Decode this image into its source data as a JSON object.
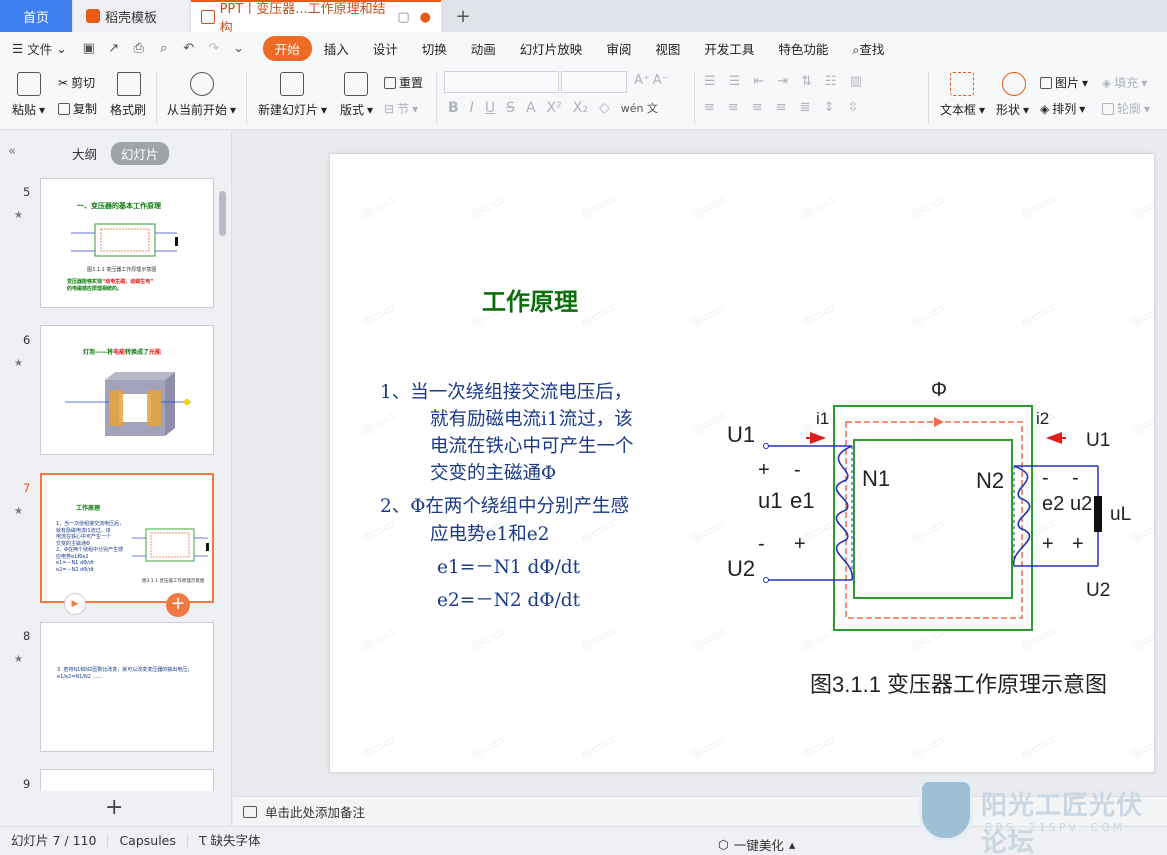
{
  "tabs": {
    "home": "首页",
    "template": "稻壳模板",
    "document": "PPT丨变压器...工作原理和结构",
    "new_tab": "+"
  },
  "menu": {
    "file": "文件",
    "items": [
      "开始",
      "插入",
      "设计",
      "切换",
      "动画",
      "幻灯片放映",
      "审阅",
      "视图",
      "开发工具",
      "特色功能"
    ],
    "search": "查找"
  },
  "ribbon": {
    "paste": "粘贴",
    "cut": "剪切",
    "copy": "复制",
    "format_painter": "格式刷",
    "from_current": "从当前开始",
    "new_slide": "新建幻灯片",
    "layout": "版式",
    "reset": "重置",
    "section": "节",
    "textbox": "文本框",
    "shape": "形状",
    "picture": "图片",
    "fill": "填充",
    "arrange": "排列",
    "outline": "轮廓",
    "phonetic": "wén 文"
  },
  "left_panel": {
    "outline_tab": "大纲",
    "slides_tab": "幻灯片",
    "slide_numbers": [
      "5",
      "6",
      "7",
      "8",
      "9"
    ],
    "thumb5": {
      "title": "一、变压器的基本工作原理",
      "caption": "图3.1.1  变压器工作原理示意图",
      "note_a": "变压器能够实现",
      "note_b": "“动电生磁，动磁生电”",
      "note_c": "的电磁感应原理相统的。"
    },
    "thumb6": {
      "title_a": "灯泡——将",
      "title_b": "电能",
      "title_c": "转换成了",
      "title_d": "光能"
    },
    "thumb7": {
      "title": "工作原理",
      "caption": "图3.1.1  变压器工作原理示意图"
    },
    "thumb8": {
      "text": "3. 若将N1和N2匝数比改变，就可以改变变压器的输出电压；e1/e2=N1/N2 ……"
    }
  },
  "slide": {
    "title": "工作原理",
    "lines": [
      "1、当一次绕组接交流电压后，",
      "就有励磁电流i1流过，该",
      "电流在铁心中可产生一个",
      "交变的主磁通Φ",
      "2、Φ在两个绕组中分别产生感",
      "应电势e1和e2",
      "e1=－N1 dΦ/dt",
      "e2=－N2 dΦ/dt"
    ],
    "diagram": {
      "phi": "Φ",
      "i1": "i1",
      "i2": "i2",
      "U1_left": "U1",
      "U2_left": "U2",
      "u1": "u1",
      "e1": "e1",
      "N1": "N1",
      "N2": "N2",
      "e2": "e2",
      "u2": "u2",
      "U1_right": "U1",
      "U2_right": "U2",
      "load": "uL",
      "plus": "+",
      "minus": "-",
      "caption": "图3.1.1  变压器工作原理示意图"
    }
  },
  "notes": {
    "placeholder": "单击此处添加备注"
  },
  "status": {
    "slide_counter": "幻灯片 7 / 110",
    "theme": "Capsules",
    "missing_font": "缺失字体",
    "beautify": "一键美化"
  },
  "logo": {
    "name": "阳光工匠光伏论坛",
    "url": "BBS. 21SPV. COM"
  }
}
